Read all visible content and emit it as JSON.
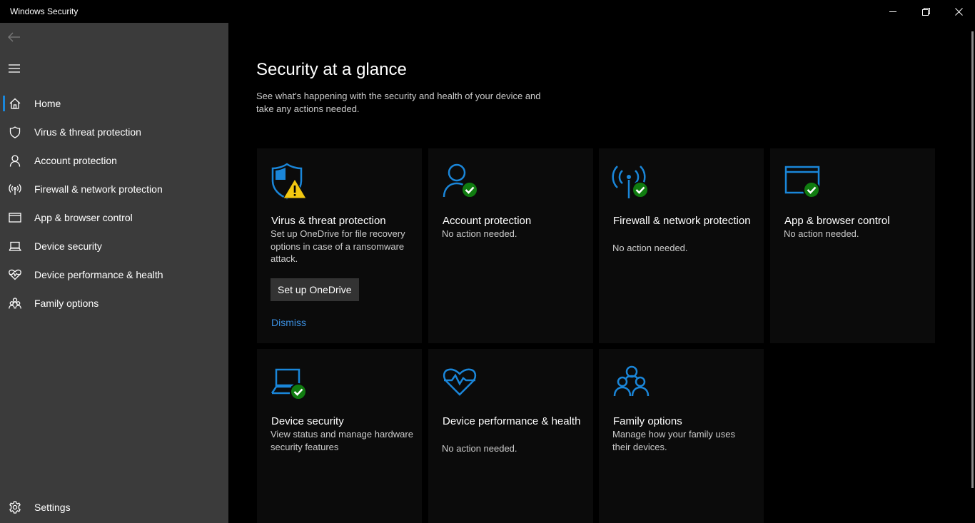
{
  "window": {
    "title": "Windows Security"
  },
  "sidebar": {
    "items": [
      {
        "label": "Home",
        "icon": "home-icon",
        "active": true
      },
      {
        "label": "Virus & threat protection",
        "icon": "shield-icon"
      },
      {
        "label": "Account protection",
        "icon": "person-icon"
      },
      {
        "label": "Firewall & network protection",
        "icon": "antenna-icon"
      },
      {
        "label": "App & browser control",
        "icon": "browser-window-icon"
      },
      {
        "label": "Device security",
        "icon": "laptop-icon"
      },
      {
        "label": "Device performance & health",
        "icon": "heart-icon"
      },
      {
        "label": "Family options",
        "icon": "family-icon"
      }
    ],
    "settings_label": "Settings"
  },
  "main": {
    "title": "Security at a glance",
    "description": "See what's happening with the security and health of your device and take any actions needed.",
    "tiles": [
      {
        "title": "Virus & threat protection",
        "desc": "Set up OneDrive for file recovery options in case of a ransomware attack.",
        "button": "Set up OneDrive",
        "link": "Dismiss",
        "status": "warning"
      },
      {
        "title": "Account protection",
        "desc": "No action needed.",
        "status": "ok"
      },
      {
        "title": "Firewall & network protection",
        "desc": "No action needed.",
        "status": "ok"
      },
      {
        "title": "App & browser control",
        "desc": "No action needed.",
        "status": "ok"
      },
      {
        "title": "Device security",
        "desc": "View status and manage hardware security features",
        "status": "ok"
      },
      {
        "title": "Device performance & health",
        "desc": "No action needed.",
        "status": "none"
      },
      {
        "title": "Family options",
        "desc": "Manage how your family uses their devices.",
        "status": "none"
      }
    ]
  },
  "colors": {
    "accent": "#1a86d9",
    "ok": "#107c10",
    "warning": "#f2c811",
    "link": "#3b8fe0",
    "sidebar_bg": "#3b3b3b",
    "tile_bg": "#0b0b0b"
  }
}
